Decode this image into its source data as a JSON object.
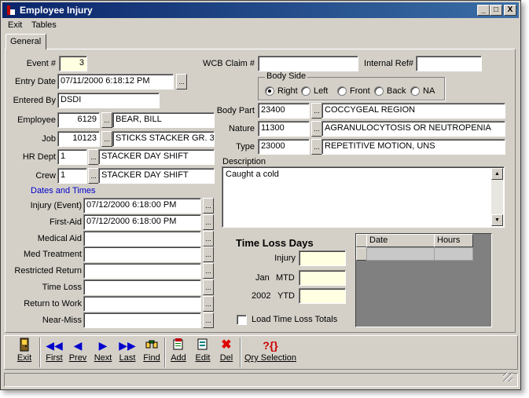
{
  "window": {
    "title": "Employee Injury",
    "controls": {
      "minimize": "_",
      "maximize": "□",
      "close": "X"
    }
  },
  "menu": [
    "Exit",
    "Tables"
  ],
  "tabs": [
    "General"
  ],
  "form": {
    "event_label": "Event #",
    "event_value": "3",
    "entry_date_label": "Entry Date",
    "entry_date_value": "07/11/2000 6:18:12 PM",
    "entered_by_label": "Entered By",
    "entered_by_value": "DSDI",
    "employee_label": "Employee",
    "employee_id": "6129",
    "employee_name": "BEAR, BILL",
    "job_label": "Job",
    "job_id": "10123",
    "job_name": "STICKS STACKER GR. 3",
    "hr_dept_label": "HR Dept",
    "hr_dept_id": "1",
    "hr_dept_name": "STACKER DAY SHIFT",
    "crew_label": "Crew",
    "crew_id": "1",
    "crew_name": "STACKER DAY SHIFT",
    "wcb_label": "WCB Claim #",
    "wcb_value": "",
    "internal_ref_label": "Internal Ref#",
    "internal_ref_value": "",
    "body_side": {
      "title": "Body Side",
      "options": [
        "Right",
        "Left",
        "Front",
        "Back",
        "NA"
      ],
      "selected": "Right"
    },
    "body_part_label": "Body Part",
    "body_part_code": "23400",
    "body_part_desc": "COCCYGEAL REGION",
    "nature_label": "Nature",
    "nature_code": "11300",
    "nature_desc": "AGRANULOCYTOSIS OR NEUTROPENIA",
    "type_label": "Type",
    "type_code": "23000",
    "type_desc": "REPETITIVE MOTION, UNS",
    "description_label": "Description",
    "description_value": "Caught a cold"
  },
  "dates": {
    "section_label": "Dates and Times",
    "rows": [
      {
        "label": "Injury (Event)",
        "value": "07/12/2000 6:18:00 PM"
      },
      {
        "label": "First-Aid",
        "value": "07/12/2000 6:18:00 PM"
      },
      {
        "label": "Medical Aid",
        "value": ""
      },
      {
        "label": "Med Treatment",
        "value": ""
      },
      {
        "label": "Restricted Return",
        "value": ""
      },
      {
        "label": "Time Loss",
        "value": ""
      },
      {
        "label": "Return to Work",
        "value": ""
      },
      {
        "label": "Near-Miss",
        "value": ""
      }
    ]
  },
  "time_loss": {
    "title": "Time Loss Days",
    "injury_label": "Injury",
    "month_label": "Jan",
    "mtd_label": "MTD",
    "year_label": "2002",
    "ytd_label": "YTD",
    "checkbox_label": "Load Time Loss Totals",
    "grid_headers": [
      "Date",
      "Hours"
    ]
  },
  "toolbar": {
    "exit": "Exit",
    "first": "First",
    "prev": "Prev",
    "next": "Next",
    "last": "Last",
    "find": "Find",
    "add": "Add",
    "edit": "Edit",
    "del": "Del",
    "qry": "Qry Selection"
  },
  "colors": {
    "title_bar": "#0a246a",
    "highlight_field": "#ffffe1",
    "section_label": "#0000cc"
  }
}
